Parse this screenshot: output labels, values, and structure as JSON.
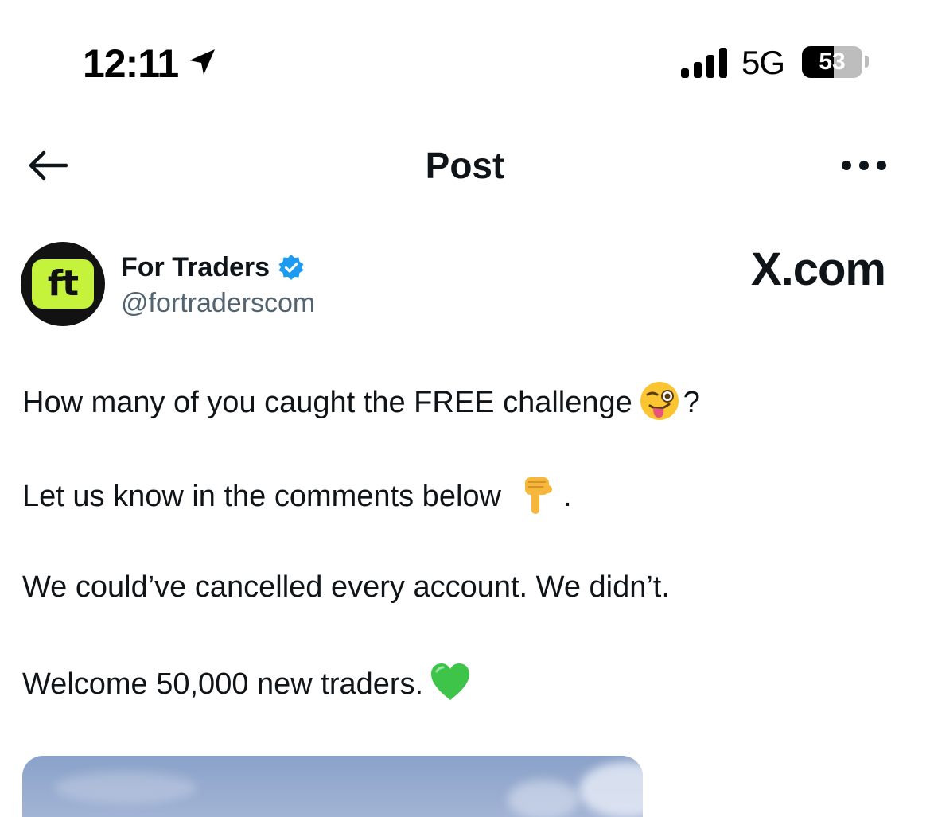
{
  "status_bar": {
    "time": "12:11",
    "network": "5G",
    "battery_level": "53",
    "battery_fraction": 0.53
  },
  "header": {
    "title": "Post",
    "back_icon": "arrow-left-icon",
    "more_icon": "more-horizontal-icon"
  },
  "author": {
    "name": "For Traders",
    "handle": "@fortraderscom",
    "avatar_text": "ft",
    "verified": true
  },
  "watermark": "X.com",
  "post": {
    "line1": "How many of you caught the FREE challenge",
    "line1_end": "?",
    "line2": "Let us know in the comments below",
    "line2_end": ".",
    "line3": "We could’ve cancelled every account. We didn’t.",
    "line4": "Welcome 50,000 new traders."
  },
  "emojis": [
    "winking-face-with-tongue-icon",
    "pointing-down-icon",
    "green-heart-icon"
  ],
  "colors": {
    "text": "#0f1419",
    "secondary": "#536471",
    "verified": "#1d9bf0",
    "avatar_bg": "#121212",
    "avatar_badge": "#c5f23a"
  }
}
